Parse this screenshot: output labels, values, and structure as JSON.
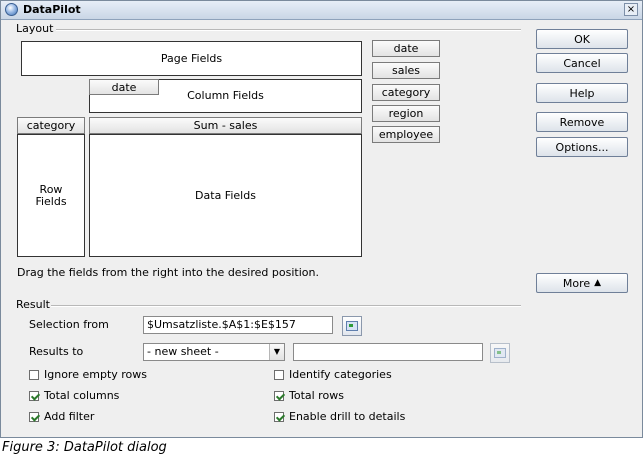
{
  "dialog": {
    "title": "DataPilot",
    "close_glyph": "×"
  },
  "layout": {
    "group_label": "Layout",
    "page_fields_label": "Page Fields",
    "column_fields_label": "Column Fields",
    "row_fields_label": "Row\nFields",
    "data_fields_label": "Data Fields",
    "column_field_button": "date",
    "row_field_button": "category",
    "data_field_button": "Sum - sales",
    "available_fields": [
      "date",
      "sales",
      "category",
      "region",
      "employee"
    ],
    "hint": "Drag the fields from the right into the desired position."
  },
  "buttons": {
    "ok": "OK",
    "cancel": "Cancel",
    "help": "Help",
    "remove": "Remove",
    "options": "Options...",
    "more": "More",
    "more_arrow": "▲"
  },
  "result": {
    "group_label": "Result",
    "selection_from_label": "Selection from",
    "selection_from_value": "$Umsatzliste.$A$1:$E$157",
    "results_to_label": "Results to",
    "results_to_selected": "- new sheet -",
    "results_to_value": "",
    "checkboxes": {
      "ignore_empty_rows": {
        "label": "Ignore empty rows",
        "checked": false
      },
      "identify_categories": {
        "label": "Identify categories",
        "checked": false
      },
      "total_columns": {
        "label": "Total columns",
        "checked": true
      },
      "total_rows": {
        "label": "Total rows",
        "checked": true
      },
      "add_filter": {
        "label": "Add filter",
        "checked": true
      },
      "enable_drill": {
        "label": "Enable drill to details",
        "checked": true
      }
    }
  },
  "caption": "Figure 3: DataPilot dialog"
}
